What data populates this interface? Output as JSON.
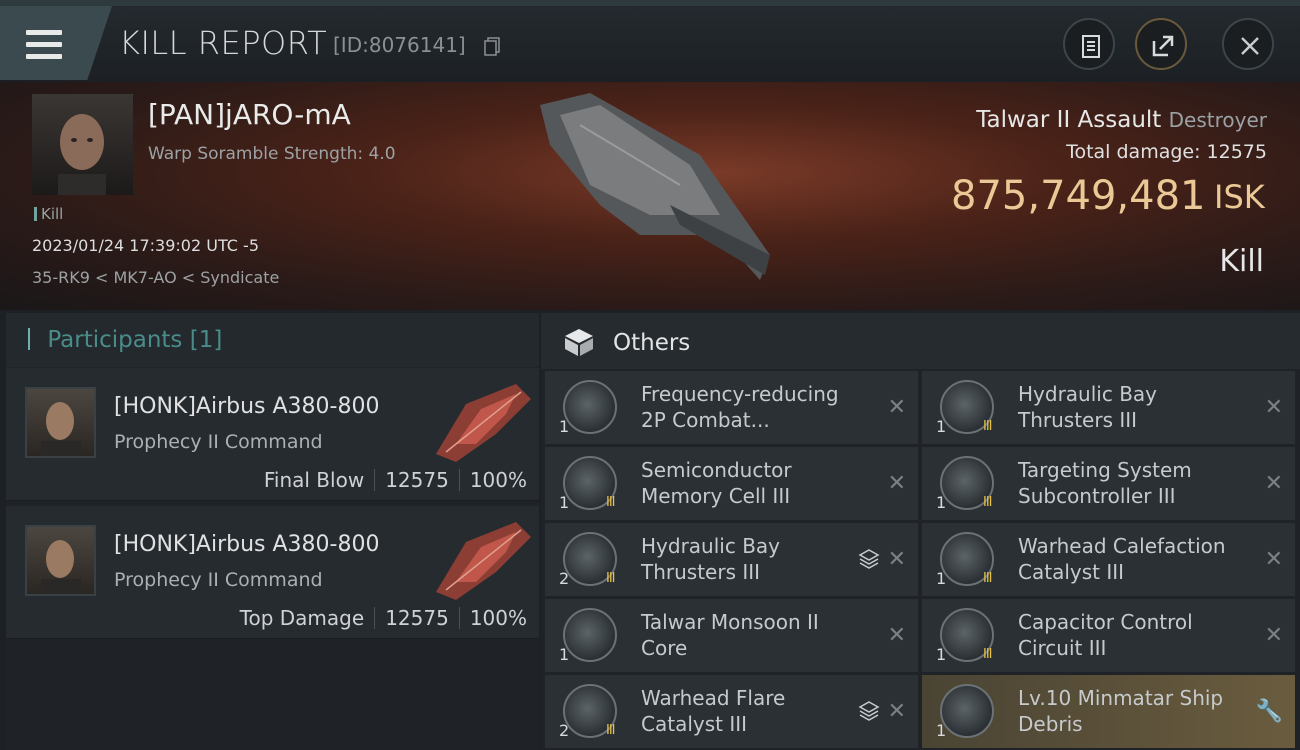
{
  "header": {
    "title": "KILL REPORT",
    "report_id": "[ID:8076141]",
    "menu_icon": "hamburger-menu-icon",
    "buttons": [
      "clipboard-icon",
      "share-icon",
      "close-icon"
    ]
  },
  "victim": {
    "name": "[PAN]jARO-mA",
    "warp_scramble": "Warp Soramble Strength: 4.0",
    "kill_tag": "Kill",
    "datetime": "2023/01/24 17:39:02 UTC -5",
    "location": "35-RK9 < MK7-AO < Syndicate",
    "ship_name": "Talwar II Assault",
    "ship_class": "Destroyer",
    "total_damage_label": "Total damage:",
    "total_damage_value": "12575",
    "isk_value": "875,749,481",
    "isk_unit": "ISK",
    "result": "Kill"
  },
  "participants": {
    "title": "Participants",
    "count": "[1]",
    "cards": [
      {
        "name": "[HONK]Airbus A380-800",
        "ship": "Prophecy II Command",
        "role": "Final Blow",
        "damage": "12575",
        "percent": "100%"
      },
      {
        "name": "[HONK]Airbus A380-800",
        "ship": "Prophecy II Command",
        "role": "Top Damage",
        "damage": "12575",
        "percent": "100%"
      }
    ]
  },
  "others": {
    "title": "Others",
    "items": [
      {
        "qty": "1",
        "name_1": "Frequency-reducing",
        "name_2": "2P Combat...",
        "level": "",
        "stack": false,
        "action": "close"
      },
      {
        "qty": "1",
        "name_1": "Hydraulic Bay",
        "name_2": "Thrusters III",
        "level": "III",
        "stack": false,
        "action": "close"
      },
      {
        "qty": "1",
        "name_1": "Semiconductor",
        "name_2": "Memory Cell III",
        "level": "III",
        "stack": false,
        "action": "close"
      },
      {
        "qty": "1",
        "name_1": "Targeting System",
        "name_2": "Subcontroller III",
        "level": "III",
        "stack": false,
        "action": "close"
      },
      {
        "qty": "2",
        "name_1": "Hydraulic Bay",
        "name_2": "Thrusters III",
        "level": "III",
        "stack": true,
        "action": "close"
      },
      {
        "qty": "1",
        "name_1": "Warhead Calefaction",
        "name_2": "Catalyst III",
        "level": "III",
        "stack": false,
        "action": "close"
      },
      {
        "qty": "1",
        "name_1": "Talwar Monsoon II",
        "name_2": "Core",
        "level": "",
        "stack": false,
        "action": "close"
      },
      {
        "qty": "1",
        "name_1": "Capacitor Control",
        "name_2": "Circuit III",
        "level": "III",
        "stack": false,
        "action": "close"
      },
      {
        "qty": "2",
        "name_1": "Warhead Flare",
        "name_2": "Catalyst III",
        "level": "III",
        "stack": true,
        "action": "close"
      },
      {
        "qty": "1",
        "name_1": "Lv.10 Minmatar Ship",
        "name_2": "Debris",
        "level": "",
        "stack": false,
        "action": "wrench"
      }
    ]
  },
  "colors": {
    "isk": "#eac997",
    "accent": "#4a8c8a",
    "level": "#e8c24a"
  }
}
